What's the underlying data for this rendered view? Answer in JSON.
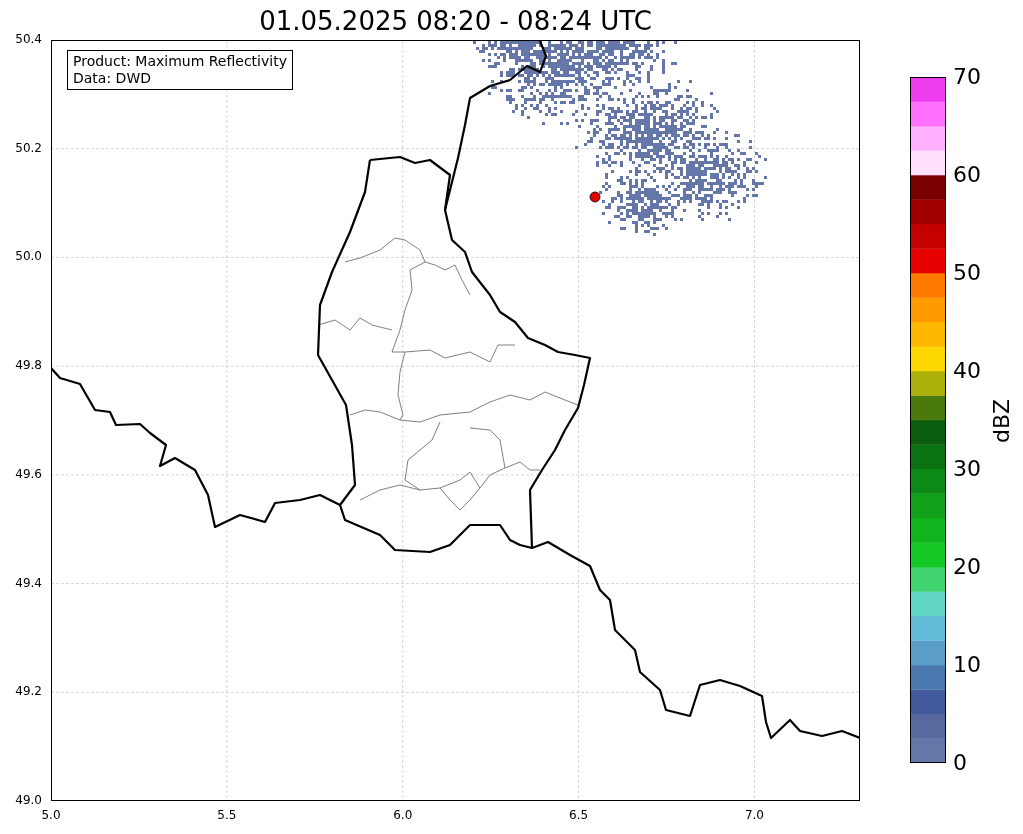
{
  "title": "01.05.2025 08:20 - 08:24 UTC",
  "map": {
    "annotation": [
      "Product: Maximum Reflectivity",
      "Data: DWD"
    ],
    "x_ticks": [
      "5.0",
      "5.5",
      "6.0",
      "6.5",
      "7.0"
    ],
    "y_ticks": [
      "50.4",
      "50.2",
      "50.0",
      "49.8",
      "49.6",
      "49.4",
      "49.2",
      "49.0"
    ]
  },
  "colorbar": {
    "label": "dBZ",
    "ticks": [
      "70",
      "60",
      "50",
      "40",
      "30",
      "20",
      "10",
      "0"
    ],
    "bands": [
      {
        "color": "#6576a8"
      },
      {
        "color": "#5869a0"
      },
      {
        "color": "#43599e"
      },
      {
        "color": "#4c7ab0"
      },
      {
        "color": "#5a9dc6"
      },
      {
        "color": "#62bcd8"
      },
      {
        "color": "#62d6c6"
      },
      {
        "color": "#40d370"
      },
      {
        "color": "#14c825"
      },
      {
        "color": "#12b51d"
      },
      {
        "color": "#10a01a"
      },
      {
        "color": "#0d8a16"
      },
      {
        "color": "#0b7212"
      },
      {
        "color": "#0a5c0f"
      },
      {
        "color": "#4a7a0c"
      },
      {
        "color": "#adb00a"
      },
      {
        "color": "#ffd700"
      },
      {
        "color": "#ffb800"
      },
      {
        "color": "#ff9b00"
      },
      {
        "color": "#ff7b00"
      },
      {
        "color": "#e60000"
      },
      {
        "color": "#c40000"
      },
      {
        "color": "#a00000"
      },
      {
        "color": "#7a0000"
      },
      {
        "color": "#ffe0ff"
      },
      {
        "color": "#ffb0ff"
      },
      {
        "color": "#ff70ff"
      },
      {
        "color": "#ee3cee"
      }
    ]
  }
}
